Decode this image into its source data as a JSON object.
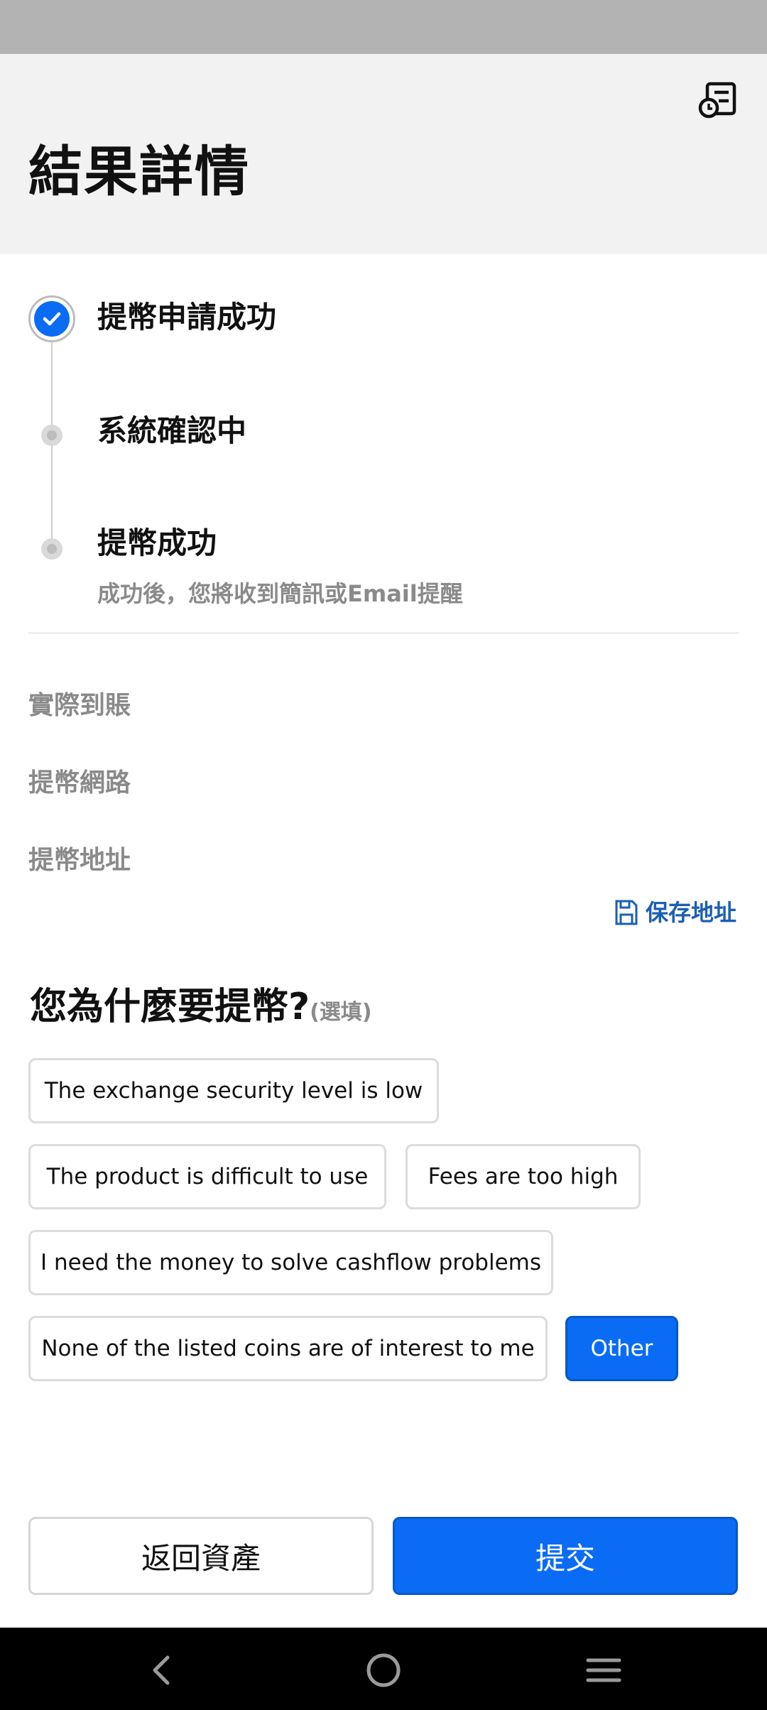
{
  "header": {
    "title": "結果詳情",
    "receipt_icon": "receipt-clock-icon"
  },
  "timeline": [
    {
      "label": "提幣申請成功",
      "state": "done"
    },
    {
      "label": "系統確認中",
      "state": "pending"
    },
    {
      "label": "提幣成功",
      "state": "pending",
      "sub": "成功後，您將收到簡訊或Email提醒"
    }
  ],
  "info": {
    "actual_received": "實際到賬",
    "network": "提幣網路",
    "address": "提幣地址",
    "save_address": "保存地址"
  },
  "reason": {
    "title": "您為什麼要提幣?",
    "optional": "(選填)",
    "options": [
      "The exchange security level is low",
      "The product is difficult to use",
      "Fees are too high",
      "I need the money to solve cashflow problems",
      "None of the listed coins are of interest to me",
      "Other"
    ],
    "selected": "Other"
  },
  "actions": {
    "back": "返回資產",
    "submit": "提交"
  },
  "colors": {
    "accent": "#0a6cf5",
    "link": "#1a5fb4",
    "muted_text": "#8a8a8a",
    "header_bg": "#f2f2f2"
  }
}
